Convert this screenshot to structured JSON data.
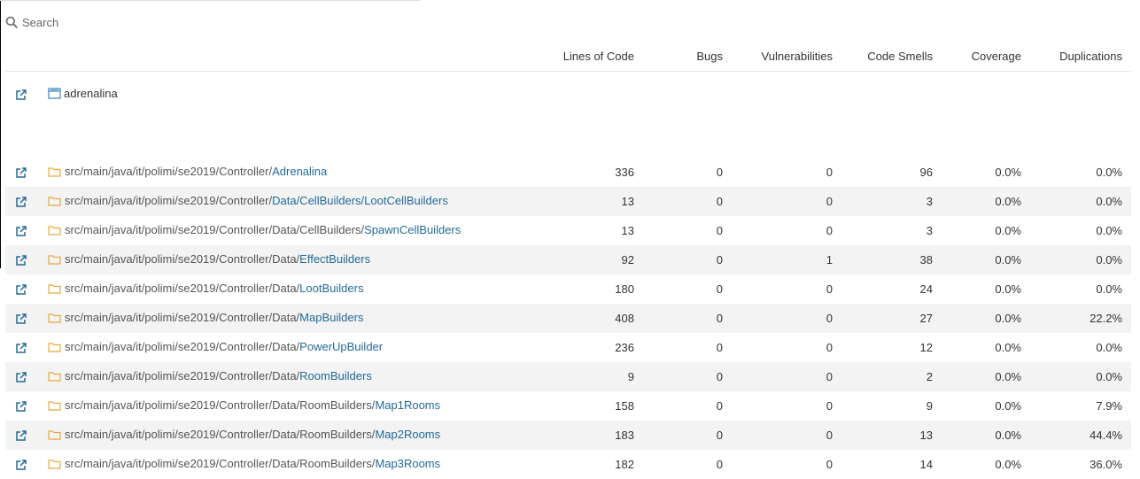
{
  "search": {
    "placeholder": "Search"
  },
  "columns": {
    "loc": "Lines of Code",
    "bugs": "Bugs",
    "vulnerabilities": "Vulnerabilities",
    "code_smells": "Code Smells",
    "coverage": "Coverage",
    "duplications": "Duplications"
  },
  "project": {
    "name": "adrenalina"
  },
  "rows": [
    {
      "prefix": "src/main/java/it/polimi/se2019/Controller/",
      "leaf": "Adrenalina",
      "loc": "336",
      "bugs": "0",
      "vulnerabilities": "0",
      "code_smells": "96",
      "coverage": "0.0%",
      "duplications": "0.0%"
    },
    {
      "prefix": "src/main/java/it/polimi/se2019/Controller/",
      "leaf": "Data/CellBuilders/LootCellBuilders",
      "loc": "13",
      "bugs": "0",
      "vulnerabilities": "0",
      "code_smells": "3",
      "coverage": "0.0%",
      "duplications": "0.0%"
    },
    {
      "prefix": "src/main/java/it/polimi/se2019/Controller/Data/CellBuilders/",
      "leaf": "SpawnCellBuilders",
      "loc": "13",
      "bugs": "0",
      "vulnerabilities": "0",
      "code_smells": "3",
      "coverage": "0.0%",
      "duplications": "0.0%"
    },
    {
      "prefix": "src/main/java/it/polimi/se2019/Controller/Data/",
      "leaf": "EffectBuilders",
      "loc": "92",
      "bugs": "0",
      "vulnerabilities": "1",
      "code_smells": "38",
      "coverage": "0.0%",
      "duplications": "0.0%"
    },
    {
      "prefix": "src/main/java/it/polimi/se2019/Controller/Data/",
      "leaf": "LootBuilders",
      "loc": "180",
      "bugs": "0",
      "vulnerabilities": "0",
      "code_smells": "24",
      "coverage": "0.0%",
      "duplications": "0.0%"
    },
    {
      "prefix": "src/main/java/it/polimi/se2019/Controller/Data/",
      "leaf": "MapBuilders",
      "loc": "408",
      "bugs": "0",
      "vulnerabilities": "0",
      "code_smells": "27",
      "coverage": "0.0%",
      "duplications": "22.2%"
    },
    {
      "prefix": "src/main/java/it/polimi/se2019/Controller/Data/",
      "leaf": "PowerUpBuilder",
      "loc": "236",
      "bugs": "0",
      "vulnerabilities": "0",
      "code_smells": "12",
      "coverage": "0.0%",
      "duplications": "0.0%"
    },
    {
      "prefix": "src/main/java/it/polimi/se2019/Controller/Data/",
      "leaf": "RoomBuilders",
      "loc": "9",
      "bugs": "0",
      "vulnerabilities": "0",
      "code_smells": "2",
      "coverage": "0.0%",
      "duplications": "0.0%"
    },
    {
      "prefix": "src/main/java/it/polimi/se2019/Controller/Data/RoomBuilders/",
      "leaf": "Map1Rooms",
      "loc": "158",
      "bugs": "0",
      "vulnerabilities": "0",
      "code_smells": "9",
      "coverage": "0.0%",
      "duplications": "7.9%"
    },
    {
      "prefix": "src/main/java/it/polimi/se2019/Controller/Data/RoomBuilders/",
      "leaf": "Map2Rooms",
      "loc": "183",
      "bugs": "0",
      "vulnerabilities": "0",
      "code_smells": "13",
      "coverage": "0.0%",
      "duplications": "44.4%"
    },
    {
      "prefix": "src/main/java/it/polimi/se2019/Controller/Data/RoomBuilders/",
      "leaf": "Map3Rooms",
      "loc": "182",
      "bugs": "0",
      "vulnerabilities": "0",
      "code_smells": "14",
      "coverage": "0.0%",
      "duplications": "36.0%"
    }
  ],
  "icons": {
    "search": "search-icon",
    "external_link": "external-link-icon",
    "folder": "folder-icon",
    "module": "module-icon"
  },
  "colors": {
    "link": "#236a97",
    "folder": "#e8a93a",
    "module": "#3a86b9",
    "stripe": "#f3f3f3"
  }
}
